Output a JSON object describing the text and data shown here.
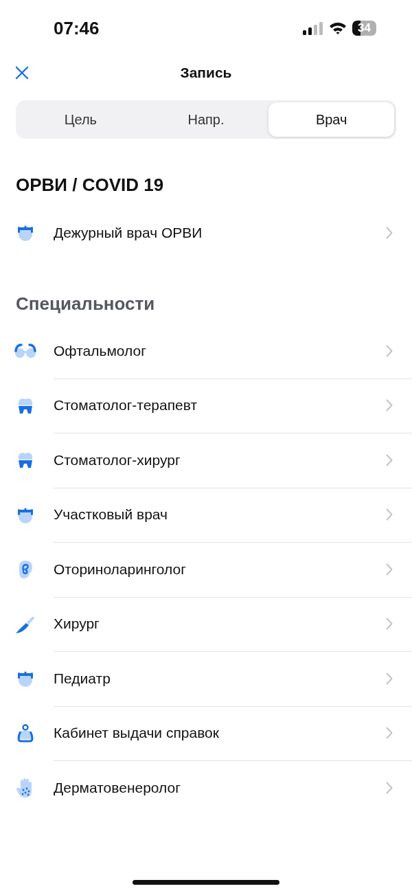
{
  "status_bar": {
    "time": "07:46",
    "battery": "34"
  },
  "header": {
    "title": "Запись"
  },
  "tabs": [
    {
      "label": "Цель",
      "selected": false
    },
    {
      "label": "Напр.",
      "selected": false
    },
    {
      "label": "Врач",
      "selected": true
    }
  ],
  "sections": [
    {
      "title": "ОРВИ / COVID 19",
      "muted": false,
      "items": [
        {
          "label": "Дежурный врач ОРВИ",
          "kind": "doctor"
        }
      ]
    },
    {
      "title": "Специальности",
      "muted": true,
      "items": [
        {
          "label": "Офтальмолог",
          "kind": "glasses"
        },
        {
          "label": "Стоматолог-терапевт",
          "kind": "tooth"
        },
        {
          "label": "Стоматолог-хирург",
          "kind": "tooth"
        },
        {
          "label": "Участковый врач",
          "kind": "doctor"
        },
        {
          "label": "Оториноларинголог",
          "kind": "ear"
        },
        {
          "label": "Хирург",
          "kind": "scalpel"
        },
        {
          "label": "Педиатр",
          "kind": "doctor"
        },
        {
          "label": "Кабинет выдачи справок",
          "kind": "person"
        },
        {
          "label": "Дерматовенеролог",
          "kind": "hand"
        }
      ]
    }
  ]
}
